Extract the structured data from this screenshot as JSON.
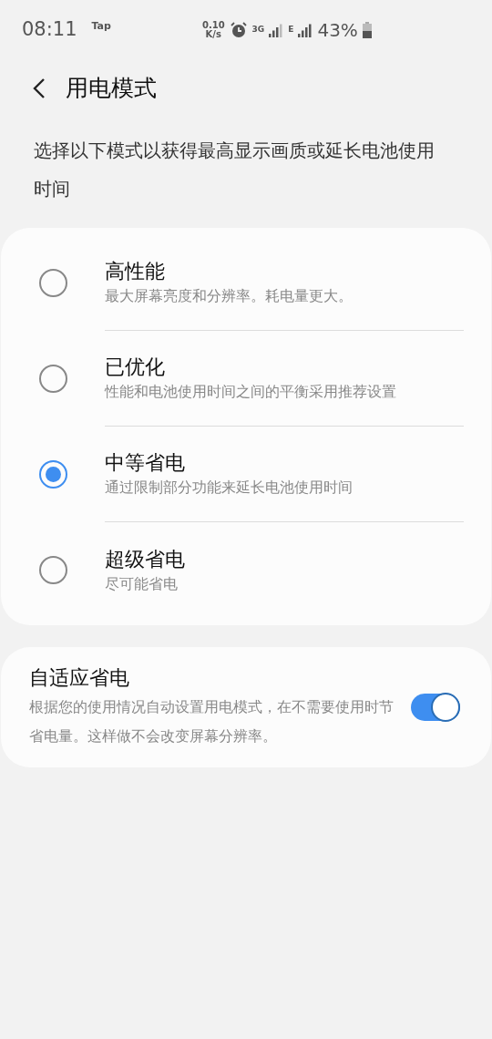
{
  "status_bar": {
    "time": "08:11",
    "app_label": "Tap",
    "speed_value": "0.10",
    "speed_unit": "K/s",
    "network_1": "3G",
    "network_2": "E",
    "battery": "43%"
  },
  "header": {
    "title": "用电模式"
  },
  "description": "选择以下模式以获得最高显示画质或延长电池使用时间",
  "modes": [
    {
      "title": "高性能",
      "subtitle": "最大屏幕亮度和分辨率。耗电量更大。",
      "selected": false
    },
    {
      "title": "已优化",
      "subtitle": "性能和电池使用时间之间的平衡采用推荐设置",
      "selected": false
    },
    {
      "title": "中等省电",
      "subtitle": "通过限制部分功能来延长电池使用时间",
      "selected": true
    },
    {
      "title": "超级省电",
      "subtitle": "尽可能省电",
      "selected": false
    }
  ],
  "adaptive": {
    "title": "自适应省电",
    "subtitle": "根据您的使用情况自动设置用电模式，在不需要使用时节省电量。这样做不会改变屏幕分辨率。",
    "on": true
  }
}
